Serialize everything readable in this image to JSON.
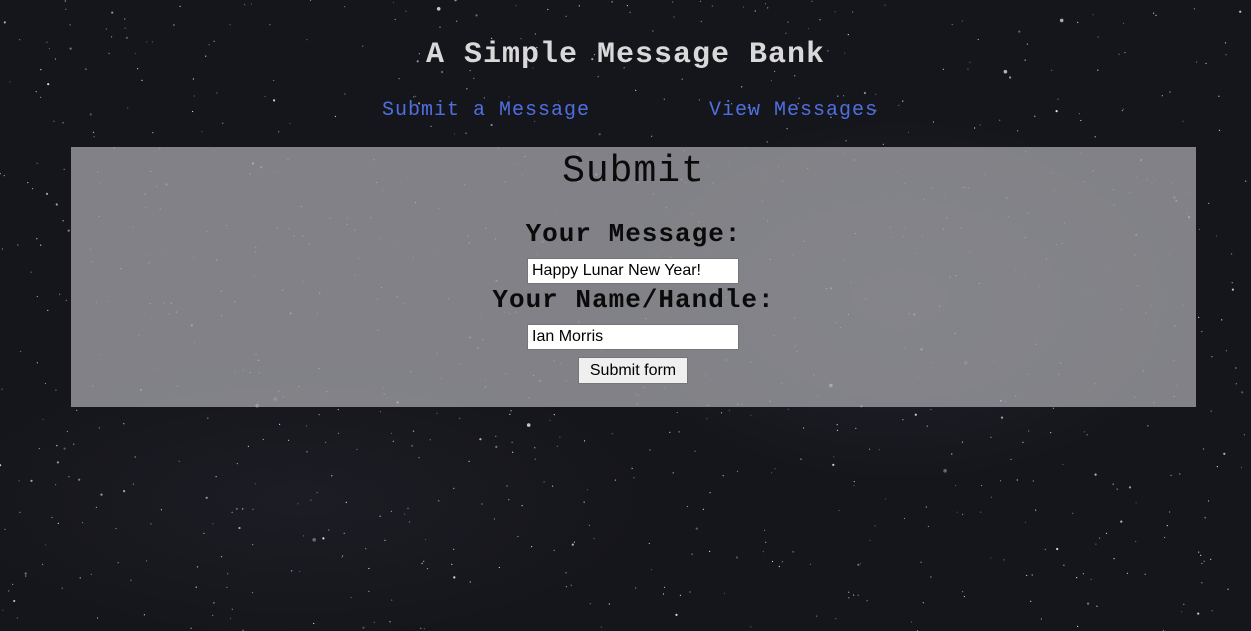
{
  "header": {
    "title": "A Simple Message Bank"
  },
  "nav": {
    "submit_label": "Submit a Message",
    "view_label": "View Messages"
  },
  "form": {
    "heading": "Submit",
    "message_label": "Your Message:",
    "message_value": "Happy Lunar New Year!",
    "name_label": "Your Name/Handle:",
    "name_value": "Ian Morris",
    "submit_label": "Submit form"
  },
  "colors": {
    "background": "#15161b",
    "link": "#4f6fe0",
    "title": "#d9d9d9",
    "panel": "#a0a0a5"
  }
}
